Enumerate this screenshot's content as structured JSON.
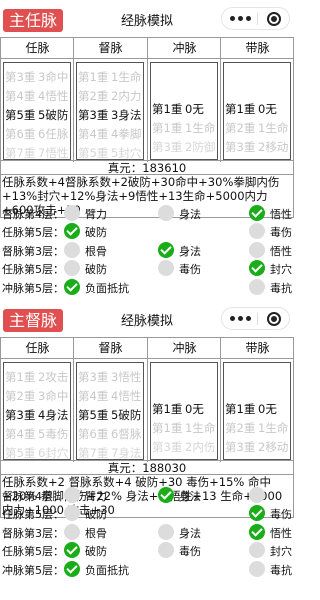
{
  "sections": [
    {
      "badge": "主任脉",
      "title": "经脉模拟",
      "columns": [
        {
          "header": "任脉",
          "rows": [
            {
              "level": "第3重",
              "value": "3命中",
              "state": "fade1"
            },
            {
              "level": "第4重",
              "value": "4悟性",
              "state": "fade1"
            },
            {
              "level": "第5重",
              "value": "5破防",
              "state": "sel"
            },
            {
              "level": "第6重",
              "value": "6任脉",
              "state": "fade1"
            },
            {
              "level": "第7重",
              "value": "7悟性",
              "state": "fade2"
            }
          ]
        },
        {
          "header": "督脉",
          "rows": [
            {
              "level": "第1重",
              "value": "1生命",
              "state": "fade1"
            },
            {
              "level": "第2重",
              "value": "2内力",
              "state": "fade1"
            },
            {
              "level": "第3重",
              "value": "3身法",
              "state": "sel"
            },
            {
              "level": "第4重",
              "value": "4拳脚",
              "state": "fade1"
            },
            {
              "level": "第5重",
              "value": "5封穴",
              "state": "fade2"
            }
          ]
        },
        {
          "header": "冲脉",
          "rows": [
            {
              "level": "第1重",
              "value": "0无",
              "state": "sel"
            },
            {
              "level": "第1重",
              "value": "1生命",
              "state": "fade1"
            },
            {
              "level": "第3重",
              "value": "2防御",
              "state": "fade2"
            }
          ]
        },
        {
          "header": "带脉",
          "rows": [
            {
              "level": "第1重",
              "value": "0无",
              "state": "sel"
            },
            {
              "level": "第2重",
              "value": "1生命",
              "state": "fade1"
            },
            {
              "level": "第3重",
              "value": "2移动",
              "state": "fade1"
            }
          ]
        }
      ],
      "zhenyuan": "真元：183610",
      "stats": "任脉系数+4督脉系数+2破防+30命中+30%拳脚内伤+13%封穴+12%身法+9悟性+13生命+5000内力+600攻击+50",
      "options": [
        {
          "label": "督脉第4层：",
          "a": {
            "text": "臂力",
            "on": false
          },
          "b": {
            "text": "身法",
            "on": false
          },
          "c": {
            "text": "悟性",
            "on": true
          }
        },
        {
          "label": "任脉第5层：",
          "a": {
            "text": "破防",
            "on": true
          },
          "b": {
            "text": "",
            "on": null
          },
          "c": {
            "text": "毒伤",
            "on": false
          }
        },
        {
          "label": "督脉第3层：",
          "a": {
            "text": "根骨",
            "on": false
          },
          "b": {
            "text": "身法",
            "on": true
          },
          "c": {
            "text": "悟性",
            "on": false
          }
        },
        {
          "label": "任脉第5层：",
          "a": {
            "text": "破防",
            "on": false
          },
          "b": {
            "text": "毒伤",
            "on": false
          },
          "c": {
            "text": "封穴",
            "on": true
          }
        },
        {
          "label": "冲脉第5层：",
          "a": {
            "text": "负面抵抗",
            "on": true
          },
          "b": {
            "text": "",
            "on": null
          },
          "c": {
            "text": "毒抗",
            "on": false
          }
        }
      ]
    },
    {
      "badge": "主督脉",
      "title": "经脉模拟",
      "columns": [
        {
          "header": "任脉",
          "rows": [
            {
              "level": "第1重",
              "value": "2攻击",
              "state": "fade1"
            },
            {
              "level": "第2重",
              "value": "3命中",
              "state": "fade1"
            },
            {
              "level": "第3重",
              "value": "4身法",
              "state": "sel"
            },
            {
              "level": "第4重",
              "value": "5毒伤",
              "state": "fade1"
            },
            {
              "level": "第5重",
              "value": "6封穴",
              "state": "fade2"
            }
          ]
        },
        {
          "header": "督脉",
          "rows": [
            {
              "level": "第3重",
              "value": "3悟性",
              "state": "fade1"
            },
            {
              "level": "第4重",
              "value": "4悟性",
              "state": "fade1"
            },
            {
              "level": "第5重",
              "value": "5破防",
              "state": "sel"
            },
            {
              "level": "第6重",
              "value": "6督脉",
              "state": "fade1"
            },
            {
              "level": "第7重",
              "value": "7身法",
              "state": "fade2"
            }
          ]
        },
        {
          "header": "冲脉",
          "rows": [
            {
              "level": "第1重",
              "value": "0无",
              "state": "sel"
            },
            {
              "level": "第1重",
              "value": "1生命",
              "state": "fade1"
            },
            {
              "level": "第3重",
              "value": "2内伤",
              "state": "fade2"
            }
          ]
        },
        {
          "header": "带脉",
          "rows": [
            {
              "level": "第1重",
              "value": "0无",
              "state": "sel"
            },
            {
              "level": "第2重",
              "value": "1生命",
              "state": "fade1"
            },
            {
              "level": "第3重",
              "value": "2移动",
              "state": "fade1"
            }
          ]
        }
      ],
      "zhenyuan": "真元：188030",
      "stats": "任脉系数+2 督脉系数+4 破防+30 毒伤+15% 命中+20% 拳脚内伤+22% 身法+9 悟性+13 生命+5000 内力+1000 攻击+30",
      "options": [
        {
          "label": "督脉第4层：",
          "a": {
            "text": "臂力",
            "on": false
          },
          "b": {
            "text": "身法",
            "on": true
          },
          "c": {
            "text": "",
            "on": false
          }
        },
        {
          "label": "任脉第5层：",
          "a": {
            "text": "破防",
            "on": false
          },
          "b": {
            "text": "",
            "on": null
          },
          "c": {
            "text": "毒伤",
            "on": true
          }
        },
        {
          "label": "督脉第3层：",
          "a": {
            "text": "根骨",
            "on": false
          },
          "b": {
            "text": "身法",
            "on": false
          },
          "c": {
            "text": "悟性",
            "on": true
          }
        },
        {
          "label": "任脉第5层：",
          "a": {
            "text": "破防",
            "on": true
          },
          "b": {
            "text": "毒伤",
            "on": false
          },
          "c": {
            "text": "封穴",
            "on": false
          }
        },
        {
          "label": "冲脉第5层：",
          "a": {
            "text": "负面抵抗",
            "on": true
          },
          "b": {
            "text": "",
            "on": null
          },
          "c": {
            "text": "毒抗",
            "on": false
          }
        }
      ]
    }
  ]
}
